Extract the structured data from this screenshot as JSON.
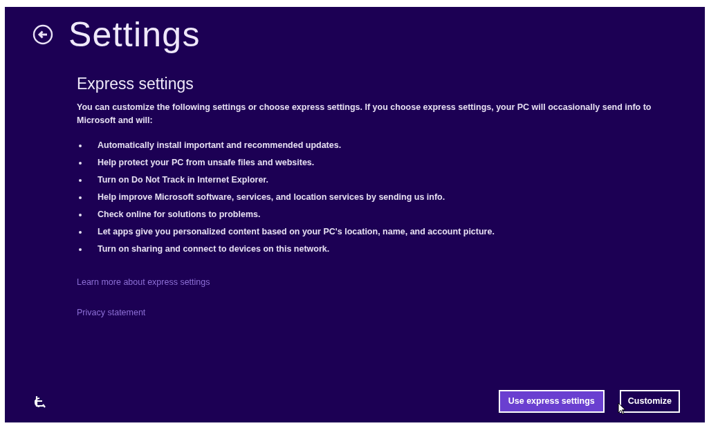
{
  "page": {
    "title": "Settings"
  },
  "section": {
    "heading": "Express settings",
    "intro": "You can customize the following settings or choose express settings. If you choose express settings, your PC will occasionally send info to Microsoft and will:",
    "items": [
      "Automatically install important and recommended updates.",
      "Help protect your PC from unsafe files and websites.",
      "Turn on Do Not Track in Internet Explorer.",
      "Help improve Microsoft software, services, and location services by sending us info.",
      "Check online for solutions to problems.",
      "Let apps give you personalized content based on your PC's location, name, and account picture.",
      "Turn on sharing and connect to devices on this network."
    ]
  },
  "links": [
    "Learn more about express settings",
    "Privacy statement"
  ],
  "buttons": [
    {
      "label": "Use express settings",
      "kind": "primary"
    },
    {
      "label": "Customize",
      "kind": "secondary"
    }
  ]
}
